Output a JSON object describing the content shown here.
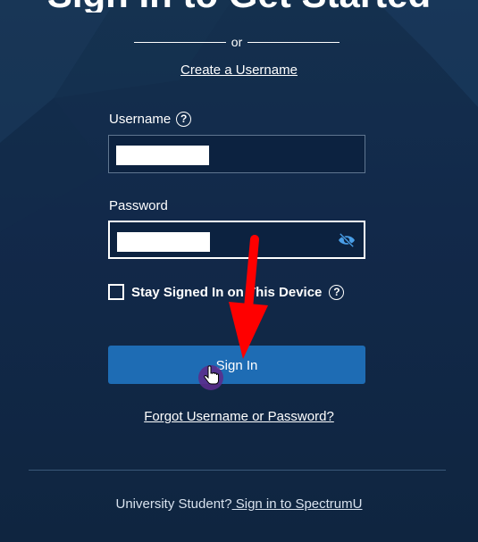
{
  "header": {
    "title": "Sign In to Get Started"
  },
  "divider": {
    "text": "or"
  },
  "links": {
    "create_username": "Create a Username",
    "forgot": "Forgot Username or Password?"
  },
  "form": {
    "username": {
      "label": "Username",
      "help_icon": "question-circle-icon",
      "value": ""
    },
    "password": {
      "label": "Password",
      "toggle_icon": "eye-slash-icon",
      "value": ""
    },
    "stay_signed_in": {
      "label": "Stay Signed In on This Device",
      "checked": false,
      "help_icon": "question-circle-icon"
    },
    "submit_label": "Sign In"
  },
  "footer": {
    "prefix": "University Student?",
    "link": " Sign in to SpectrumU"
  },
  "annotation": {
    "arrow_icon": "red-arrow-icon",
    "cursor_icon": "hand-pointer-icon",
    "arrow_color": "#ff0000"
  },
  "colors": {
    "background": "#12294a",
    "button": "#1e6cb4",
    "input_bg": "#0c2240"
  }
}
